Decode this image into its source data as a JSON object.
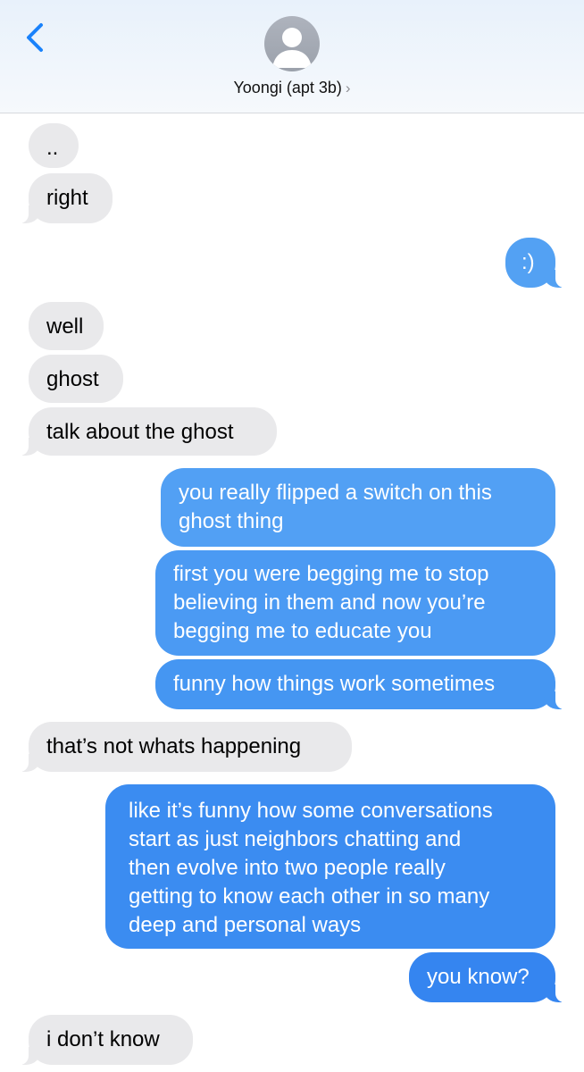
{
  "header": {
    "contact_name": "Yoongi (apt 3b)",
    "chevron": "›",
    "back_icon": "chevron-left-icon",
    "avatar_icon": "person-silhouette-icon"
  },
  "colors": {
    "incoming_bubble": "#e9e9eb",
    "outgoing_bubble_top": "#55a4f5",
    "outgoing_bubble_bottom": "#2f7cf0",
    "accent": "#1a82fb"
  },
  "messages": [
    {
      "sender": "them",
      "text": ".."
    },
    {
      "sender": "them",
      "text": "right"
    },
    {
      "sender": "me",
      "text": ":)"
    },
    {
      "sender": "them",
      "text": "well"
    },
    {
      "sender": "them",
      "text": "ghost"
    },
    {
      "sender": "them",
      "text": "talk about the ghost"
    },
    {
      "sender": "me",
      "lines": [
        "you really flipped a switch on this",
        "ghost thing"
      ]
    },
    {
      "sender": "me",
      "lines": [
        "first you were begging me to stop",
        "believing in them and now you’re",
        "begging me to educate you"
      ]
    },
    {
      "sender": "me",
      "text": "funny how things work sometimes"
    },
    {
      "sender": "them",
      "text": "that’s not whats happening"
    },
    {
      "sender": "me",
      "lines": [
        "like it’s funny how some conversations",
        "start as just neighbors chatting and",
        "then evolve into two people really",
        "getting to know each other in so many",
        "deep and personal ways"
      ]
    },
    {
      "sender": "me",
      "text": "you know?"
    },
    {
      "sender": "them",
      "text": "i don’t know"
    }
  ]
}
